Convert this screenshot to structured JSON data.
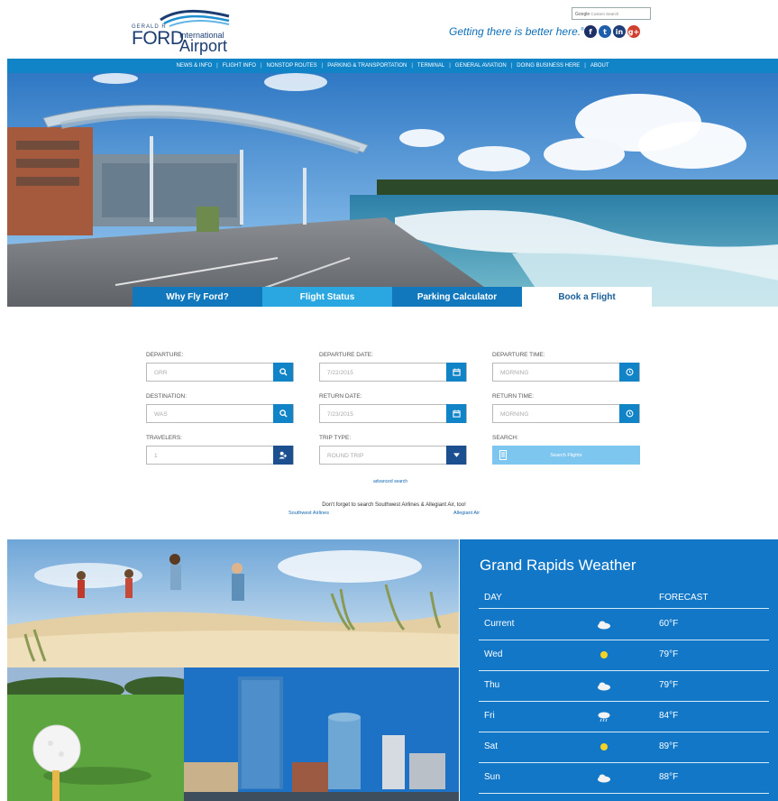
{
  "header": {
    "logo": {
      "line1": "GERALD R",
      "line2": "FORD",
      "line3": "International",
      "line4": "Airport"
    },
    "tagline": "Getting there is better here.",
    "tagline_mark": "®",
    "search": {
      "brand": "Google",
      "placeholder": "Custom Search"
    },
    "social": [
      {
        "name": "facebook-icon",
        "glyph": "f"
      },
      {
        "name": "twitter-icon",
        "glyph": "t"
      },
      {
        "name": "linkedin-icon",
        "glyph": "in"
      },
      {
        "name": "googleplus-icon",
        "glyph": "g+"
      }
    ]
  },
  "nav": {
    "items": [
      "NEWS & INFO",
      "FLIGHT INFO",
      "NONSTOP ROUTES",
      "PARKING & TRANSPORTATION",
      "TERMINAL",
      "GENERAL AVIATION",
      "DOING BUSINESS HERE",
      "ABOUT"
    ],
    "separator": "|"
  },
  "tabs": [
    {
      "label": "Why Fly Ford?"
    },
    {
      "label": "Flight Status"
    },
    {
      "label": "Parking Calculator"
    },
    {
      "label": "Book a Flight",
      "active": true
    }
  ],
  "booking": {
    "departure": {
      "label": "DEPARTURE:",
      "value": "GRR",
      "icon": "search-icon"
    },
    "departure_date": {
      "label": "DEPARTURE DATE:",
      "value": "7/22/2015",
      "icon": "calendar-icon"
    },
    "departure_time": {
      "label": "DEPARTURE TIME:",
      "value": "MORNING",
      "icon": "clock-icon"
    },
    "destination": {
      "label": "DESTINATION:",
      "value": "WAS",
      "icon": "search-icon"
    },
    "return_date": {
      "label": "RETURN DATE:",
      "value": "7/23/2015",
      "icon": "calendar-icon"
    },
    "return_time": {
      "label": "RETURN TIME:",
      "value": "MORNING",
      "icon": "clock-icon"
    },
    "travelers": {
      "label": "TRAVELERS:",
      "value": "1",
      "icon": "add-user-icon"
    },
    "trip_type": {
      "label": "TRIP TYPE:",
      "value": "ROUND TRIP",
      "icon": "chevron-down-icon"
    },
    "search": {
      "label": "SEARCH:",
      "button": "Search Flights",
      "icon": "document-icon"
    },
    "advanced": "advanced search",
    "reminder": "Don't forget to search Southwest Airlines & Allegiant Air, too!",
    "southwest": "Southwest Airlines",
    "allegiant": "Allegiant Air"
  },
  "weather": {
    "title": "Grand Rapids Weather",
    "col_day": "DAY",
    "col_forecast": "FORECAST",
    "rows": [
      {
        "day": "Current",
        "icon": "cloudy-icon",
        "temp": "60°F"
      },
      {
        "day": "Wed",
        "icon": "sunny-icon",
        "temp": "79°F"
      },
      {
        "day": "Thu",
        "icon": "cloudy-icon",
        "temp": "79°F"
      },
      {
        "day": "Fri",
        "icon": "rain-icon",
        "temp": "84°F"
      },
      {
        "day": "Sat",
        "icon": "sunny-icon",
        "temp": "89°F"
      },
      {
        "day": "Sun",
        "icon": "cloudy-icon",
        "temp": "88°F"
      }
    ]
  },
  "colors": {
    "brand_blue": "#1184c7",
    "tab_light": "#2aa7e0",
    "weather_bg": "#1277c7",
    "search_button": "#7cc6ef"
  }
}
